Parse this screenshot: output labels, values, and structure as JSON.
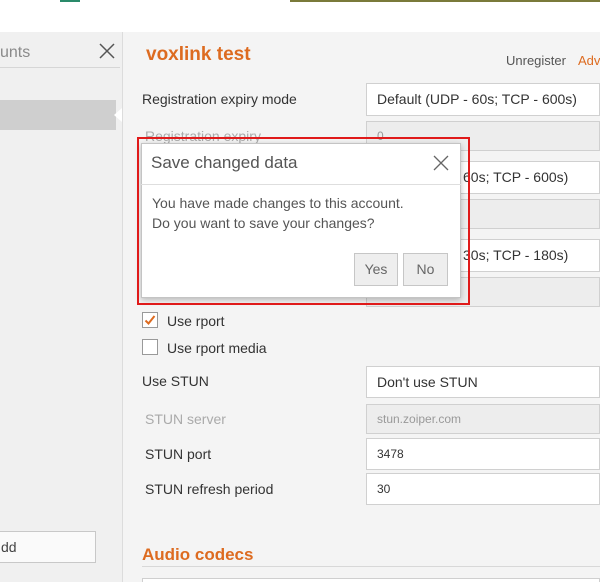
{
  "left_panel": {
    "title": "unts",
    "add_button": "dd"
  },
  "account": {
    "title": "voxlink test",
    "unregister": "Unregister",
    "advanced": "Adv"
  },
  "form": {
    "reg_expiry_mode_label": "Registration expiry mode",
    "reg_expiry_mode_value": "Default (UDP - 60s; TCP - 600s)",
    "reg_expiry_label": "Registration expiry",
    "reg_expiry_value": "0",
    "row3_value_partial": "60s; TCP - 600s)",
    "row5_value_partial": "30s; TCP - 180s)",
    "use_rport_label": "Use rport",
    "use_rport_checked": true,
    "use_rport_media_label": "Use rport media",
    "use_rport_media_checked": false,
    "use_stun_label": "Use STUN",
    "use_stun_value": "Don't use STUN",
    "stun_server_label": "STUN server",
    "stun_server_value": "stun.zoiper.com",
    "stun_port_label": "STUN port",
    "stun_port_value": "3478",
    "stun_refresh_label": "STUN refresh period",
    "stun_refresh_value": "30"
  },
  "section": {
    "audio_codecs": "Audio codecs"
  },
  "dialog": {
    "title": "Save changed data",
    "message_line1": "You have made changes to this account.",
    "message_line2": "Do you want to save your changes?",
    "yes": "Yes",
    "no": "No"
  },
  "colors": {
    "accent": "#dd6b20",
    "highlight": "#e01a1a"
  }
}
